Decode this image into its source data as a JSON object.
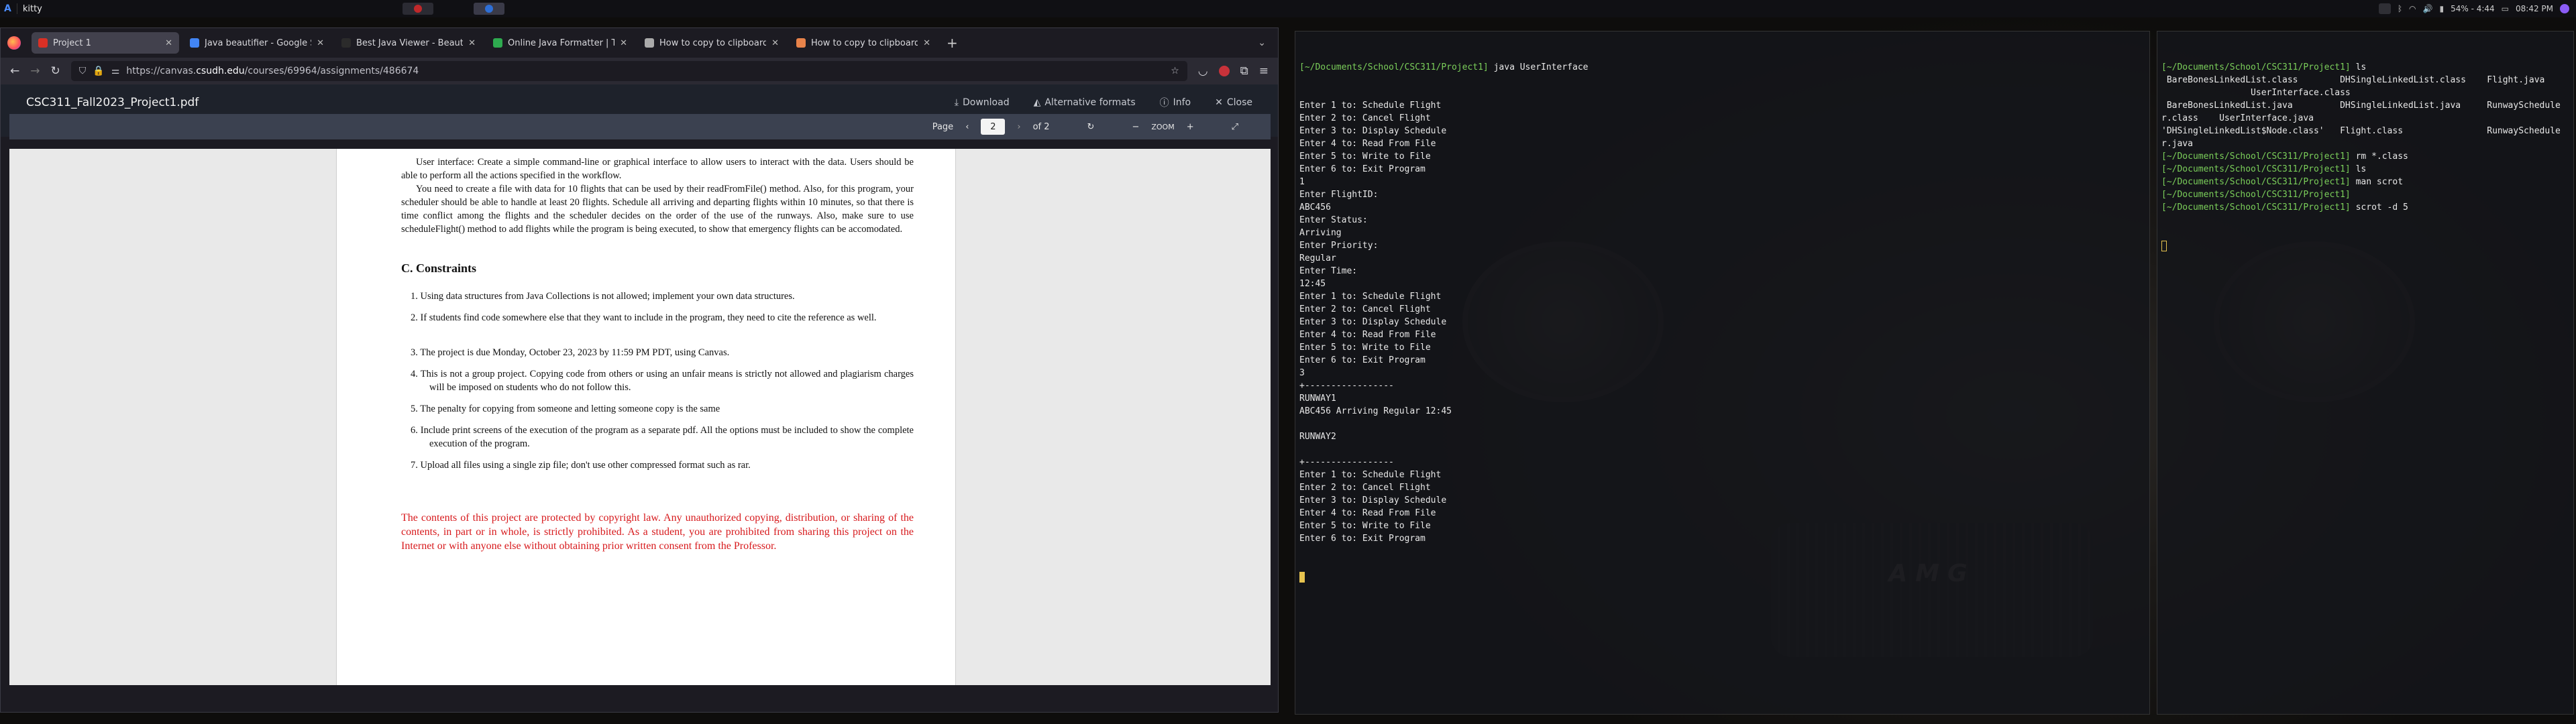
{
  "topbar": {
    "app_icon": "arch-logo-icon",
    "window_title": "kitty",
    "battery": "54% - 4:44",
    "clock": "08:42 PM"
  },
  "browser": {
    "tabs": [
      {
        "label": "Project 1",
        "favicon_color": "#d93025"
      },
      {
        "label": "Java beautifier - Google Se",
        "favicon_color": "#4285f4"
      },
      {
        "label": "Best Java Viewer - Beautify",
        "favicon_color": "#2b2b2b"
      },
      {
        "label": "Online Java Formatter | Tu",
        "favicon_color": "#2eaa4f"
      },
      {
        "label": "How to copy to clipboard i",
        "favicon_color": "#aaaaaa"
      },
      {
        "label": "How to copy to clipboard in",
        "favicon_color": "#e8834a"
      }
    ],
    "url_prefix": "https://canvas.",
    "url_host": "csudh.edu",
    "url_path": "/courses/69964/assignments/486674"
  },
  "pdf": {
    "filename": "CSC311_Fall2023_Project1.pdf",
    "download": "Download",
    "alternative": "Alternative formats",
    "info": "Info",
    "close": "Close",
    "page_label": "Page",
    "page_current": "2",
    "page_total": "of 2",
    "zoom": "ZOOM",
    "para1": "User interface: Create a simple command-line or graphical interface to allow users to interact with the data. Users should be able to perform all the actions specified in the workflow.",
    "para2": "You need to create a file with data for 10 flights that can be used by their readFromFile() method. Also, for this program, your scheduler should be able to handle at least 20 flights. Schedule all arriving and departing flights within 10 minutes, so that there is time conflict among the flights and the scheduler decides on the order of the use of the runways. Also, make sure to use scheduleFlight() method to add flights while the program is being executed, to show that emergency flights can be accomodated.",
    "section": "C. Constraints",
    "constraints": [
      "1. Using data structures from Java Collections is not allowed; implement your own data structures.",
      "2. If students find code somewhere else that they want to include in the program, they need to cite the reference as well.",
      "3. The project is due Monday, October 23, 2023 by 11:59 PM PDT, using Canvas.",
      "4. This is not a group project. Copying code from others or using an unfair means is strictly not allowed and plagiarism charges will be imposed on students who do not follow this.",
      "5. The penalty for copying from someone and letting someone copy is the same",
      "6. Include print screens of the execution of the program as a separate pdf.  All the options must be included to show the complete execution of the program.",
      "7. Upload all files using a single zip file; don't use other compressed format such as rar."
    ],
    "warning": "The contents of this project are protected by copyright law.  Any unauthorized copying, distribution, or sharing of the contents, in part or in whole, is strictly prohibited.  As a student, you are prohibited from sharing this project on the Internet or with anyone else without obtaining prior written consent from the Professor."
  },
  "terminal1": {
    "prompt_dir": "[~/Documents/School/CSC311/Project1]",
    "prompt_cmd": " java UserInterface",
    "lines": [
      "Enter 1 to: Schedule Flight",
      "Enter 2 to: Cancel Flight",
      "Enter 3 to: Display Schedule",
      "Enter 4 to: Read From File",
      "Enter 5 to: Write to File",
      "Enter 6 to: Exit Program",
      "1",
      "Enter FlightID:",
      "ABC456",
      "Enter Status:",
      "Arriving",
      "Enter Priority:",
      "Regular",
      "Enter Time:",
      "12:45",
      "Enter 1 to: Schedule Flight",
      "Enter 2 to: Cancel Flight",
      "Enter 3 to: Display Schedule",
      "Enter 4 to: Read From File",
      "Enter 5 to: Write to File",
      "Enter 6 to: Exit Program",
      "3",
      "+-----------------",
      "RUNWAY1",
      "ABC456 Arriving Regular 12:45",
      "",
      "RUNWAY2",
      "",
      "+-----------------",
      "Enter 1 to: Schedule Flight",
      "Enter 2 to: Cancel Flight",
      "Enter 3 to: Display Schedule",
      "Enter 4 to: Read From File",
      "Enter 5 to: Write to File",
      "Enter 6 to: Exit Program"
    ]
  },
  "terminal2": {
    "lines": [
      {
        "dir": "[~/Documents/School/CSC311/Project1]",
        "cmd": " ls"
      },
      {
        "out": " BareBonesLinkedList.class        DHSingleLinkedList.class    Flight.java"
      },
      {
        "out": "                 UserInterface.class"
      },
      {
        "out": " BareBonesLinkedList.java         DHSingleLinkedList.java     RunwaySchedule"
      },
      {
        "out": "r.class    UserInterface.java"
      },
      {
        "out": "'DHSingleLinkedList$Node.class'   Flight.class                RunwaySchedule"
      },
      {
        "out": "r.java"
      },
      {
        "dir": "[~/Documents/School/CSC311/Project1]",
        "cmd": " rm *.class"
      },
      {
        "dir": "[~/Documents/School/CSC311/Project1]",
        "cmd": " ls"
      },
      {
        "dir": "[~/Documents/School/CSC311/Project1]",
        "cmd": " man scrot"
      },
      {
        "dir": "[~/Documents/School/CSC311/Project1]",
        "cmd": ""
      },
      {
        "dir": "[~/Documents/School/CSC311/Project1]",
        "cmd": " scrot -d 5"
      }
    ]
  }
}
